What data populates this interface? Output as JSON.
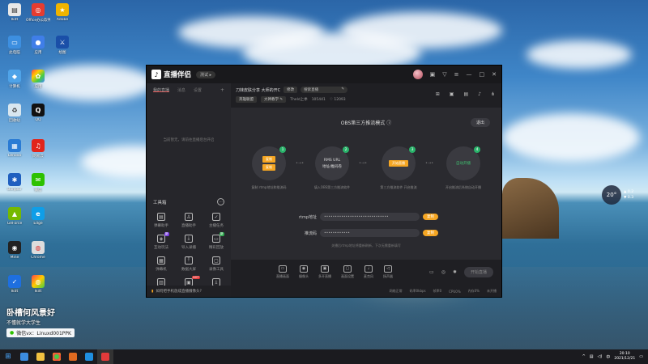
{
  "desktop": {
    "icons_col1": [
      "Ikdt",
      "此电脑",
      "计算机",
      "回收站",
      "Lenovo",
      "Bonjour",
      "GeForce",
      "Mine",
      "Ikdt"
    ],
    "icons_col2": [
      "Office办公软件",
      "应用",
      "应用",
      "QQ",
      "网易云",
      "微信",
      "Edge",
      "Chrome",
      "Ikdt"
    ],
    "icons_col3": [
      "Adobe",
      "绘图"
    ]
  },
  "watermark": {
    "line1": "卧槽何风景好",
    "line2": "不懂就学大学生",
    "wechat": "微信vx：Linuxd001PPK"
  },
  "weather": {
    "temp": "20°",
    "line1": "0.2",
    "line2": "0.3"
  },
  "app": {
    "name": "直播伴侣",
    "version": "测试",
    "left_tabs": [
      "我的直播",
      "消息",
      "设置"
    ],
    "left_empty": "当前暂无，请前往直播后台开启",
    "tools_title": "工具箱",
    "tools": [
      {
        "label": "弹幕助手",
        "icon": "chat-icon",
        "badge": ""
      },
      {
        "label": "直播助手",
        "icon": "person-icon",
        "badge": ""
      },
      {
        "label": "主播任务",
        "icon": "task-icon",
        "badge": ""
      },
      {
        "label": "互动玩法",
        "icon": "game-icon",
        "badge": "新"
      },
      {
        "label": "导入录播",
        "icon": "download-icon",
        "badge": ""
      },
      {
        "label": "精彩回放",
        "icon": "replay-icon",
        "badge": "新"
      },
      {
        "label": "弹幕机",
        "icon": "board-icon",
        "badge": ""
      },
      {
        "label": "数据大屏",
        "icon": "upload-icon",
        "badge": ""
      },
      {
        "label": "录像工具",
        "icon": "record-icon",
        "badge": ""
      },
      {
        "label": "",
        "icon": "blank-icon",
        "badge": ""
      },
      {
        "label": "",
        "icon": "hot-icon",
        "badge": "HOT"
      },
      {
        "label": "",
        "icon": "download2-icon",
        "badge": ""
      }
    ],
    "left_footer": "如何把手机放成直播摄像头?",
    "header": {
      "room_title": "刀妹皮肤分享 大师的开C",
      "edit_btn": "修改",
      "search_box": "搜索直播",
      "category": "英雄联盟",
      "subcat": "大神教学",
      "meta1": "Theld上季",
      "meta2": "105441",
      "meta3": "12093"
    },
    "obs": {
      "title": "OBS第三方推流模式",
      "exit": "退出",
      "steps": [
        {
          "num": "1",
          "btn1": "复制",
          "btn2": "复制",
          "caption": "复制 rtmp地址和推流码"
        },
        {
          "num": "2",
          "line1": "RMS URL",
          "line2": "地址/推码卷",
          "caption": "填入OBS第三方推流软件"
        },
        {
          "num": "3",
          "btn": "开始直播",
          "caption": "第三方推流软件 开启推流"
        },
        {
          "num": "4",
          "line1": "自动开播",
          "caption": "开启推流后系统自动开播"
        }
      ],
      "rtmp_label": "rtmp地址",
      "rtmp_value": "••••••••••••••••••••••••••••••",
      "key_label": "推流码",
      "key_value": "••••••••••••",
      "copy": "复制",
      "hint": "关播后rtmp地址将重新刷新，下次无需重新填写"
    },
    "controls": [
      {
        "label": "直播画面",
        "icon": "screen-icon"
      },
      {
        "label": "摄像头",
        "icon": "camera-icon"
      },
      {
        "label": "多开直播",
        "icon": "multi-icon"
      },
      {
        "label": "画面设置",
        "icon": "settings-screen-icon"
      },
      {
        "label": "麦克风",
        "icon": "mic-icon"
      },
      {
        "label": "扬声器",
        "icon": "speaker-icon"
      }
    ],
    "go_live": "开始直播",
    "status": [
      "网络正常",
      "码率0kbps",
      "帧率0",
      "CPU0%",
      "内存0%",
      "未开播"
    ]
  },
  "taskbar": {
    "time": "20:10",
    "date": "2021/12/21"
  }
}
